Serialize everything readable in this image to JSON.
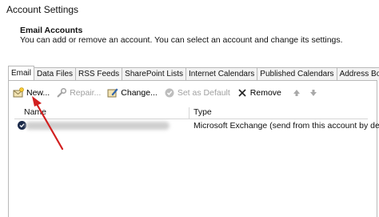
{
  "window": {
    "title": "Account Settings"
  },
  "header": {
    "title": "Email Accounts",
    "description": "You can add or remove an account. You can select an account and change its settings."
  },
  "tabs": [
    {
      "label": "Email",
      "active": true
    },
    {
      "label": "Data Files"
    },
    {
      "label": "RSS Feeds"
    },
    {
      "label": "SharePoint Lists"
    },
    {
      "label": "Internet Calendars"
    },
    {
      "label": "Published Calendars"
    },
    {
      "label": "Address Books"
    }
  ],
  "toolbar": {
    "new_label": "New...",
    "repair_label": "Repair...",
    "change_label": "Change...",
    "default_label": "Set as Default",
    "remove_label": "Remove"
  },
  "list": {
    "headers": {
      "name": "Name",
      "type": "Type"
    },
    "rows": [
      {
        "type": "Microsoft Exchange (send from this account by def..."
      }
    ]
  },
  "colors": {
    "annotation_arrow": "#d21f1f",
    "checkmark": "#1b2a4a"
  }
}
